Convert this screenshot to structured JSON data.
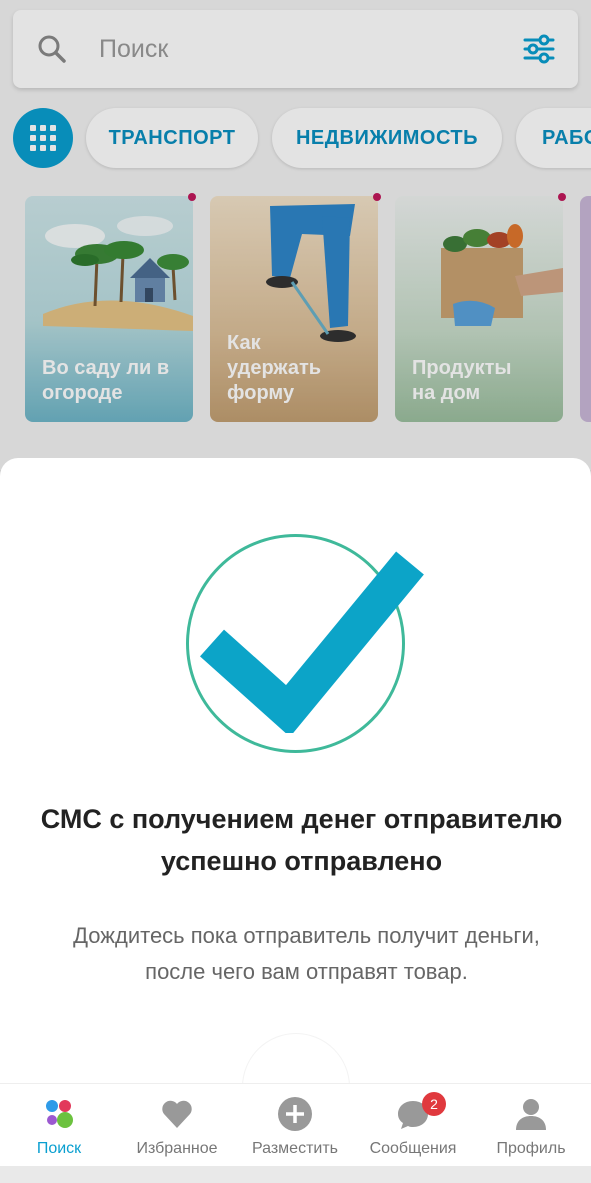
{
  "search": {
    "placeholder": "Поиск"
  },
  "categories": [
    {
      "label": "ТРАНСПОРТ"
    },
    {
      "label": "НЕДВИЖИМОСТЬ"
    },
    {
      "label": "РАБО"
    }
  ],
  "stories": [
    {
      "title": "Во саду ли в огороде"
    },
    {
      "title": "Как удержать форму"
    },
    {
      "title": "Продукты на дом"
    }
  ],
  "modal": {
    "icon": "checkmark-circle-icon",
    "title_line1": "СМС с получением денег отправителю",
    "title_line2": "успешно отправлено",
    "text_line1": "Дождитесь пока отправитель получит деньги,",
    "text_line2": "после чего вам отправят товар."
  },
  "nav": {
    "search": "Поиск",
    "favorites": "Избранное",
    "post": "Разместить",
    "messages": "Сообщения",
    "messages_badge": "2",
    "profile": "Профиль"
  },
  "colors": {
    "accent": "#0a9fd0",
    "check": "#0ca4c8",
    "check_circle": "#3fb99a",
    "badge": "#e0393e"
  }
}
